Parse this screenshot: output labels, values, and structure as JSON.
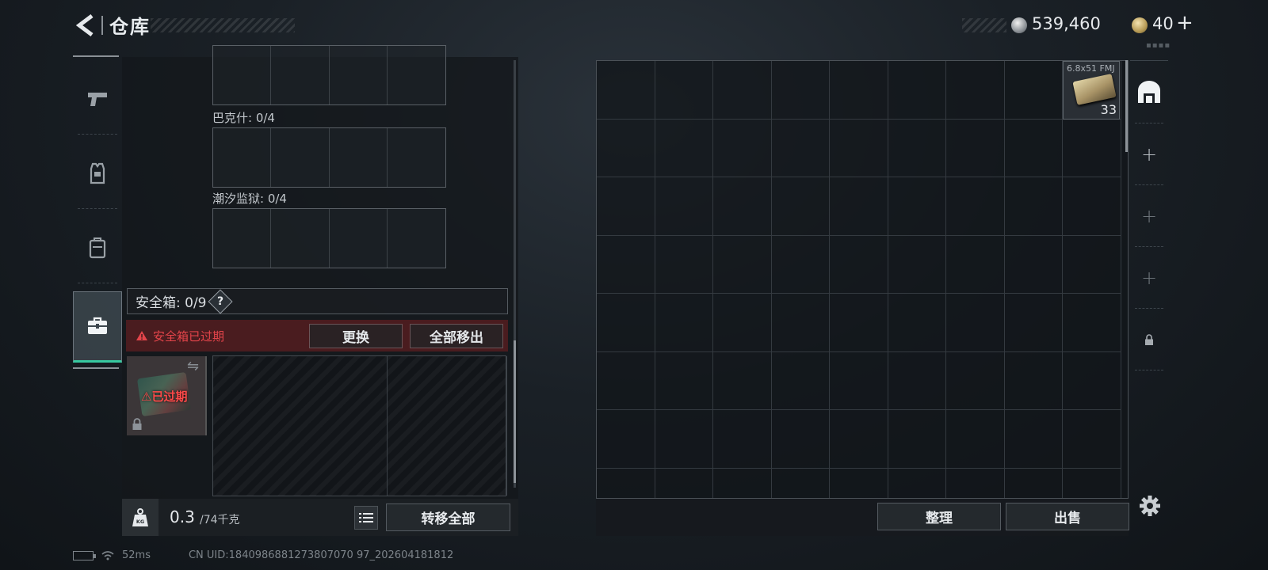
{
  "header": {
    "title": "仓库",
    "back_icon": "back-arrow-icon",
    "silver_currency": "539,460",
    "gold_currency": "40",
    "add_label": "+"
  },
  "left_tabs": [
    {
      "icon": "pistol-icon",
      "active": false
    },
    {
      "icon": "armor-vest-icon",
      "active": false
    },
    {
      "icon": "backpack-icon",
      "active": false
    },
    {
      "icon": "toolbox-icon",
      "active": true
    }
  ],
  "container_sections": [
    {
      "label": "巴克什: 0/4"
    },
    {
      "label": "潮汐监狱: 0/4"
    }
  ],
  "safe_box": {
    "label": "安全箱: 0/9",
    "help": "?",
    "expired_warning": "安全箱已过期",
    "replace_button": "更换",
    "remove_all_button": "全部移出",
    "case_status": "已过期"
  },
  "weight": {
    "current": "0.3",
    "max": "/74千克",
    "icon_label": "KG"
  },
  "transfer_all_button": "转移全部",
  "status_bar": {
    "ping": "52ms",
    "uid": "CN UID:1840986881273807070 97_202604181812"
  },
  "stash": {
    "ammo": {
      "name": "6.8x51 FMJ",
      "count": "33"
    },
    "sort_button": "整理",
    "sell_button": "出售"
  },
  "colors": {
    "accent_green": "#37c9a0",
    "warning_red": "#e3444a",
    "expired_bar": "#4a1c1f"
  }
}
